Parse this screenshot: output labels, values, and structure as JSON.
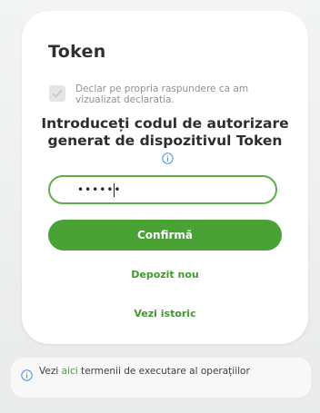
{
  "title": "Token",
  "declaration": {
    "checked": true,
    "text": "Declar pe propria raspundere ca am vizualizat declaratia."
  },
  "instruction": "Introduceți codul de autorizare generat de dispozitivul Token",
  "code_field": {
    "value": "••••••"
  },
  "buttons": {
    "confirm": "Confirmă"
  },
  "links": {
    "deposit": "Depozit nou",
    "history": "Vezi istoric"
  },
  "footer": {
    "prefix": "Vezi",
    "link": "aici",
    "suffix": "termenii de executare al operațiilor"
  },
  "colors": {
    "accent": "#49a233",
    "link": "#3f9a2d",
    "info_icon": "#4a90d9"
  }
}
